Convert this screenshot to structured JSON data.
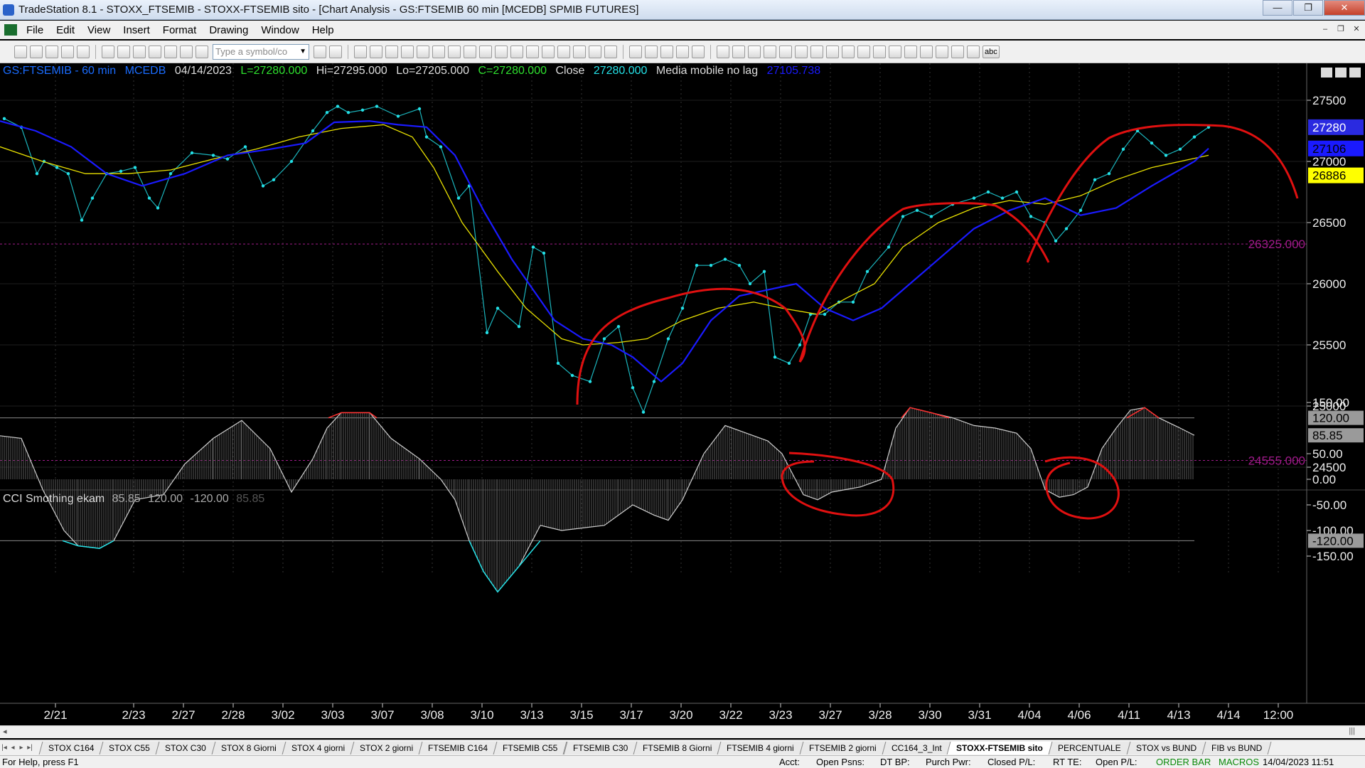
{
  "window": {
    "title": "TradeStation 8.1 - STOXX_FTSEMIB - STOXX-FTSEMIB sito - [Chart Analysis - GS:FTSEMIB  60 min  [MCEDB] SPMIB FUTURES]"
  },
  "menu": [
    "File",
    "Edit",
    "View",
    "Insert",
    "Format",
    "Drawing",
    "Window",
    "Help"
  ],
  "toolbar": {
    "symbol_placeholder": "Type a symbol/co",
    "abc_label": "abc"
  },
  "readout": {
    "symbol": "GS:FTSEMIB - 60 min",
    "study": "MCEDB",
    "date": "04/14/2023",
    "low_last": "L=27280.000",
    "high": "Hi=27295.000",
    "low": "Lo=27205.000",
    "close": "C=27280.000",
    "close_label": "Close",
    "close_value": "27280.000",
    "ma_label": "Media mobile no lag",
    "ma_value": "27105.738"
  },
  "colors": {
    "price": "#23e0e6",
    "ma_fast": "#1a1aff",
    "ma_slow": "#e8e000",
    "annotation": "#e01010",
    "level": "#a01a8a",
    "grid": "#333333"
  },
  "price_axis": {
    "ticks": [
      "27500",
      "27000",
      "26500",
      "26000",
      "25500",
      "25000",
      "24500"
    ]
  },
  "price_badges": {
    "last": "27280",
    "ma_fast": "27106",
    "ma_slow": "26886"
  },
  "levels": {
    "upper": "26325.000",
    "lower": "24555.000"
  },
  "cci": {
    "label": "CCI Smothing ekam",
    "values": [
      "85.85",
      "120.00",
      "-120.00",
      "85.85"
    ],
    "axis_ticks": [
      "150.00",
      "50.00",
      "0.00",
      "-50.00",
      "-100.00",
      "-150.00"
    ],
    "badges": {
      "upper": "120.00",
      "current": "85.85",
      "lower": "-120.00"
    }
  },
  "x_axis": {
    "dates": [
      "2/21",
      "2/23",
      "2/27",
      "2/28",
      "3/02",
      "3/03",
      "3/07",
      "3/08",
      "3/10",
      "3/13",
      "3/15",
      "3/17",
      "3/20",
      "3/22",
      "3/23",
      "3/27",
      "3/28",
      "3/30",
      "3/31",
      "4/04",
      "4/06",
      "4/11",
      "4/13",
      "4/14",
      "12:00"
    ]
  },
  "tabs": [
    "STOX C164",
    "STOX C55",
    "STOX  C30",
    "STOX  8 Giorni",
    "STOX 4 giorni",
    "STOX  2 giorni",
    "FTSEMIB C164",
    "FTSEMIB C55",
    "FTSEMIB C30",
    "FTSEMIB  8 Giorni",
    "FTSEMIB  4 giorni",
    "FTSEMIB  2 giorni",
    "CC164_3_Int",
    "STOXX-FTSEMIB sito",
    "PERCENTUALE",
    "STOX vs BUND",
    "FIB vs BUND"
  ],
  "active_tab": "STOXX-FTSEMIB sito",
  "status": {
    "help": "For Help, press F1",
    "acct": "Acct:",
    "open_psns": "Open Psns:",
    "dt_bp": "DT BP:",
    "purch_pwr": "Purch Pwr:",
    "closed_pl": "Closed P/L:",
    "rt_te": "RT TE:",
    "open_pl": "Open P/L:",
    "order_bar": "ORDER BAR",
    "macros": "MACROS",
    "datetime": "14/04/2023 11:51"
  }
}
